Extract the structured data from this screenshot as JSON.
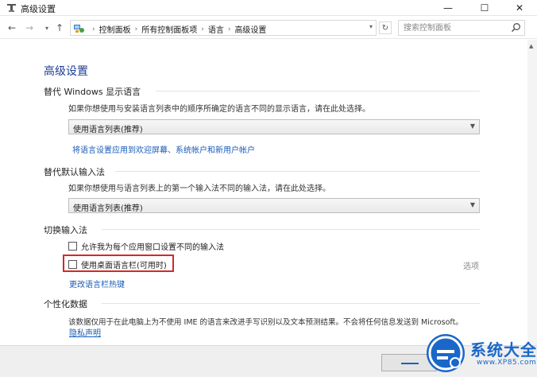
{
  "window": {
    "title": "高级设置",
    "controls": {
      "minimize": "—",
      "maximize": "☐",
      "close": "✕"
    }
  },
  "nav": {
    "back": "←",
    "forward": "→",
    "recent": "▾",
    "up": "↑",
    "breadcrumbs": [
      "控制面板",
      "所有控制面板项",
      "语言",
      "高级设置"
    ],
    "separator": "›",
    "dropdown": "▾",
    "refresh": "↻",
    "search_placeholder": "搜索控制面板"
  },
  "page": {
    "heading": "高级设置",
    "display_language": {
      "title": "替代 Windows 显示语言",
      "description": "如果你想使用与安装语言列表中的顺序所确定的语言不同的显示语言，请在此处选择。",
      "select_value": "使用语言列表(推荐)",
      "link": "将语言设置应用到欢迎屏幕、系统帐户和新用户帐户"
    },
    "input_method": {
      "title": "替代默认输入法",
      "description": "如果你想使用与语言列表上的第一个输入法不同的输入法，请在此处选择。",
      "select_value": "使用语言列表(推荐)"
    },
    "switch_input": {
      "title": "切换输入法",
      "checkbox_per_app": "允许我为每个应用窗口设置不同的输入法",
      "checkbox_language_bar": "使用桌面语言栏(可用时)",
      "options_link": "选项",
      "hotkeys_link": "更改语言栏热键"
    },
    "personalization": {
      "title": "个性化数据",
      "description": "该数据仅用于在此电脑上为不使用 IME 的语言来改进手写识别以及文本预测结果。不会将任何信息发送到 Microsoft。",
      "privacy_link": "隐私声明"
    }
  },
  "watermark": {
    "text": "系统大全",
    "url": "www.XP85.com"
  },
  "colors": {
    "heading": "#1e3d96",
    "link": "#1a5bb8",
    "highlight": "#d12a2a",
    "watermark": "#1b67c9"
  }
}
